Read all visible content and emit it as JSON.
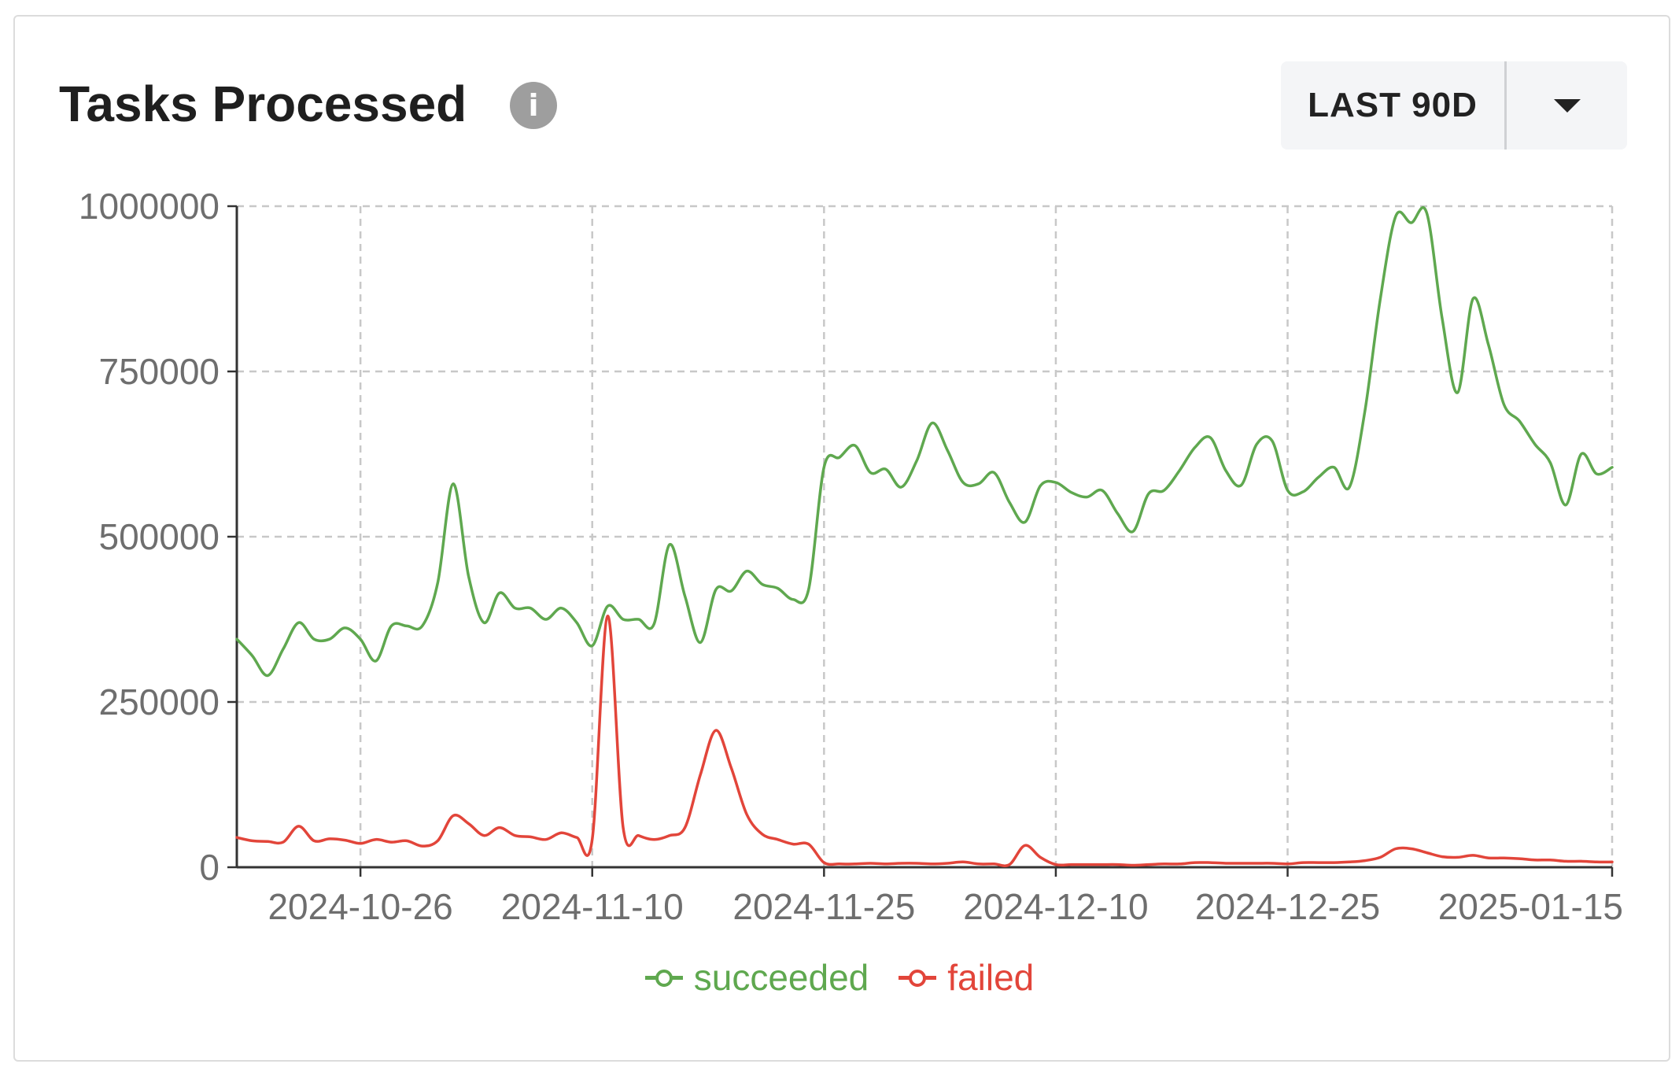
{
  "header": {
    "title": "Tasks Processed",
    "info_icon": "info-icon",
    "range_label": "LAST 90D",
    "dropdown_icon": "caret-down-icon"
  },
  "colors": {
    "succeeded": "#5fa84f",
    "failed": "#e2453a",
    "grid": "#c8c8c8",
    "axis": "#333333",
    "tick_text": "#6e6e6e"
  },
  "chart_data": {
    "type": "line",
    "title": "Tasks Processed",
    "xlabel": "",
    "ylabel": "",
    "x_range": [
      "2024-10-18",
      "2025-01-15"
    ],
    "ylim": [
      0,
      1000000
    ],
    "y_ticks": [
      0,
      250000,
      500000,
      750000,
      1000000
    ],
    "y_tick_labels": [
      "0",
      "250000",
      "500000",
      "750000",
      "1000000"
    ],
    "x_ticks": [
      "2024-10-26",
      "2024-11-10",
      "2024-11-25",
      "2024-12-10",
      "2024-12-25",
      "2025-01-15"
    ],
    "grid": true,
    "legend": "bottom-center",
    "series": [
      {
        "name": "succeeded",
        "points": [
          [
            "2024-10-18",
            345000
          ],
          [
            "2024-10-19",
            320000
          ],
          [
            "2024-10-20",
            290000
          ],
          [
            "2024-10-21",
            330000
          ],
          [
            "2024-10-22",
            370000
          ],
          [
            "2024-10-23",
            345000
          ],
          [
            "2024-10-24",
            345000
          ],
          [
            "2024-10-25",
            362000
          ],
          [
            "2024-10-26",
            345000
          ],
          [
            "2024-10-27",
            312000
          ],
          [
            "2024-10-28",
            365000
          ],
          [
            "2024-10-29",
            365000
          ],
          [
            "2024-10-30",
            365000
          ],
          [
            "2024-10-31",
            430000
          ],
          [
            "2024-11-01",
            580000
          ],
          [
            "2024-11-02",
            440000
          ],
          [
            "2024-11-03",
            370000
          ],
          [
            "2024-11-04",
            415000
          ],
          [
            "2024-11-05",
            392000
          ],
          [
            "2024-11-06",
            392000
          ],
          [
            "2024-11-07",
            375000
          ],
          [
            "2024-11-08",
            392000
          ],
          [
            "2024-11-09",
            370000
          ],
          [
            "2024-11-10",
            335000
          ],
          [
            "2024-11-11",
            395000
          ],
          [
            "2024-11-12",
            375000
          ],
          [
            "2024-11-13",
            375000
          ],
          [
            "2024-11-14",
            368000
          ],
          [
            "2024-11-15",
            488000
          ],
          [
            "2024-11-16",
            410000
          ],
          [
            "2024-11-17",
            340000
          ],
          [
            "2024-11-18",
            420000
          ],
          [
            "2024-11-19",
            418000
          ],
          [
            "2024-11-20",
            448000
          ],
          [
            "2024-11-21",
            428000
          ],
          [
            "2024-11-22",
            422000
          ],
          [
            "2024-11-23",
            405000
          ],
          [
            "2024-11-24",
            420000
          ],
          [
            "2024-11-25",
            605000
          ],
          [
            "2024-11-26",
            620000
          ],
          [
            "2024-11-27",
            638000
          ],
          [
            "2024-11-28",
            597000
          ],
          [
            "2024-11-29",
            602000
          ],
          [
            "2024-11-30",
            575000
          ],
          [
            "2024-12-01",
            615000
          ],
          [
            "2024-12-02",
            672000
          ],
          [
            "2024-12-03",
            630000
          ],
          [
            "2024-12-04",
            582000
          ],
          [
            "2024-12-05",
            580000
          ],
          [
            "2024-12-06",
            597000
          ],
          [
            "2024-12-07",
            552000
          ],
          [
            "2024-12-08",
            522000
          ],
          [
            "2024-12-09",
            577000
          ],
          [
            "2024-12-10",
            582000
          ],
          [
            "2024-12-11",
            567000
          ],
          [
            "2024-12-12",
            560000
          ],
          [
            "2024-12-13",
            570000
          ],
          [
            "2024-12-14",
            535000
          ],
          [
            "2024-12-15",
            508000
          ],
          [
            "2024-12-16",
            565000
          ],
          [
            "2024-12-17",
            570000
          ],
          [
            "2024-12-18",
            600000
          ],
          [
            "2024-12-19",
            635000
          ],
          [
            "2024-12-20",
            650000
          ],
          [
            "2024-12-21",
            600000
          ],
          [
            "2024-12-22",
            578000
          ],
          [
            "2024-12-23",
            640000
          ],
          [
            "2024-12-24",
            645000
          ],
          [
            "2024-12-25",
            570000
          ],
          [
            "2024-12-26",
            568000
          ],
          [
            "2024-12-27",
            590000
          ],
          [
            "2024-12-28",
            605000
          ],
          [
            "2024-12-29",
            575000
          ],
          [
            "2024-12-30",
            690000
          ],
          [
            "2024-12-31",
            860000
          ],
          [
            "2025-01-01",
            985000
          ],
          [
            "2025-01-02",
            975000
          ],
          [
            "2025-01-03",
            990000
          ],
          [
            "2025-01-04",
            830000
          ],
          [
            "2025-01-05",
            718000
          ],
          [
            "2025-01-06",
            860000
          ],
          [
            "2025-01-07",
            790000
          ],
          [
            "2025-01-08",
            700000
          ],
          [
            "2025-01-09",
            675000
          ],
          [
            "2025-01-10",
            640000
          ],
          [
            "2025-01-11",
            612000
          ],
          [
            "2025-01-12",
            548000
          ],
          [
            "2025-01-13",
            625000
          ],
          [
            "2025-01-14",
            595000
          ],
          [
            "2025-01-15",
            605000
          ]
        ]
      },
      {
        "name": "failed",
        "points": [
          [
            "2024-10-18",
            45000
          ],
          [
            "2024-10-19",
            40000
          ],
          [
            "2024-10-20",
            39000
          ],
          [
            "2024-10-21",
            38000
          ],
          [
            "2024-10-22",
            62000
          ],
          [
            "2024-10-23",
            40000
          ],
          [
            "2024-10-24",
            43000
          ],
          [
            "2024-10-25",
            41000
          ],
          [
            "2024-10-26",
            36000
          ],
          [
            "2024-10-27",
            42000
          ],
          [
            "2024-10-28",
            38000
          ],
          [
            "2024-10-29",
            40000
          ],
          [
            "2024-10-30",
            32000
          ],
          [
            "2024-10-31",
            40000
          ],
          [
            "2024-11-01",
            78000
          ],
          [
            "2024-11-02",
            66000
          ],
          [
            "2024-11-03",
            48000
          ],
          [
            "2024-11-04",
            60000
          ],
          [
            "2024-11-05",
            48000
          ],
          [
            "2024-11-06",
            46000
          ],
          [
            "2024-11-07",
            42000
          ],
          [
            "2024-11-08",
            52000
          ],
          [
            "2024-11-09",
            45000
          ],
          [
            "2024-11-10",
            42000
          ],
          [
            "2024-11-11",
            380000
          ],
          [
            "2024-11-12",
            60000
          ],
          [
            "2024-11-13",
            48000
          ],
          [
            "2024-11-14",
            42000
          ],
          [
            "2024-11-15",
            48000
          ],
          [
            "2024-11-16",
            60000
          ],
          [
            "2024-11-17",
            140000
          ],
          [
            "2024-11-18",
            207000
          ],
          [
            "2024-11-19",
            150000
          ],
          [
            "2024-11-20",
            80000
          ],
          [
            "2024-11-21",
            50000
          ],
          [
            "2024-11-22",
            42000
          ],
          [
            "2024-11-23",
            35000
          ],
          [
            "2024-11-24",
            35000
          ],
          [
            "2024-11-25",
            7000
          ],
          [
            "2024-11-26",
            5000
          ],
          [
            "2024-11-27",
            5000
          ],
          [
            "2024-11-28",
            6000
          ],
          [
            "2024-11-29",
            5000
          ],
          [
            "2024-11-30",
            6000
          ],
          [
            "2024-12-01",
            6000
          ],
          [
            "2024-12-02",
            5000
          ],
          [
            "2024-12-03",
            6000
          ],
          [
            "2024-12-04",
            8000
          ],
          [
            "2024-12-05",
            5000
          ],
          [
            "2024-12-06",
            5000
          ],
          [
            "2024-12-07",
            4000
          ],
          [
            "2024-12-08",
            33000
          ],
          [
            "2024-12-09",
            15000
          ],
          [
            "2024-12-10",
            4000
          ],
          [
            "2024-12-11",
            4000
          ],
          [
            "2024-12-12",
            4000
          ],
          [
            "2024-12-13",
            4000
          ],
          [
            "2024-12-14",
            4000
          ],
          [
            "2024-12-15",
            3000
          ],
          [
            "2024-12-16",
            4000
          ],
          [
            "2024-12-17",
            5000
          ],
          [
            "2024-12-18",
            5000
          ],
          [
            "2024-12-19",
            7000
          ],
          [
            "2024-12-20",
            7000
          ],
          [
            "2024-12-21",
            6000
          ],
          [
            "2024-12-22",
            6000
          ],
          [
            "2024-12-23",
            6000
          ],
          [
            "2024-12-24",
            6000
          ],
          [
            "2024-12-25",
            5000
          ],
          [
            "2024-12-26",
            7000
          ],
          [
            "2024-12-27",
            7000
          ],
          [
            "2024-12-28",
            7000
          ],
          [
            "2024-12-29",
            8000
          ],
          [
            "2024-12-30",
            10000
          ],
          [
            "2024-12-31",
            15000
          ],
          [
            "2025-01-01",
            28000
          ],
          [
            "2025-01-02",
            28000
          ],
          [
            "2025-01-03",
            22000
          ],
          [
            "2025-01-04",
            16000
          ],
          [
            "2025-01-05",
            15000
          ],
          [
            "2025-01-06",
            18000
          ],
          [
            "2025-01-07",
            14000
          ],
          [
            "2025-01-08",
            14000
          ],
          [
            "2025-01-09",
            13000
          ],
          [
            "2025-01-10",
            11000
          ],
          [
            "2025-01-11",
            11000
          ],
          [
            "2025-01-12",
            9000
          ],
          [
            "2025-01-13",
            9000
          ],
          [
            "2025-01-14",
            8000
          ],
          [
            "2025-01-15",
            8000
          ]
        ]
      }
    ]
  }
}
